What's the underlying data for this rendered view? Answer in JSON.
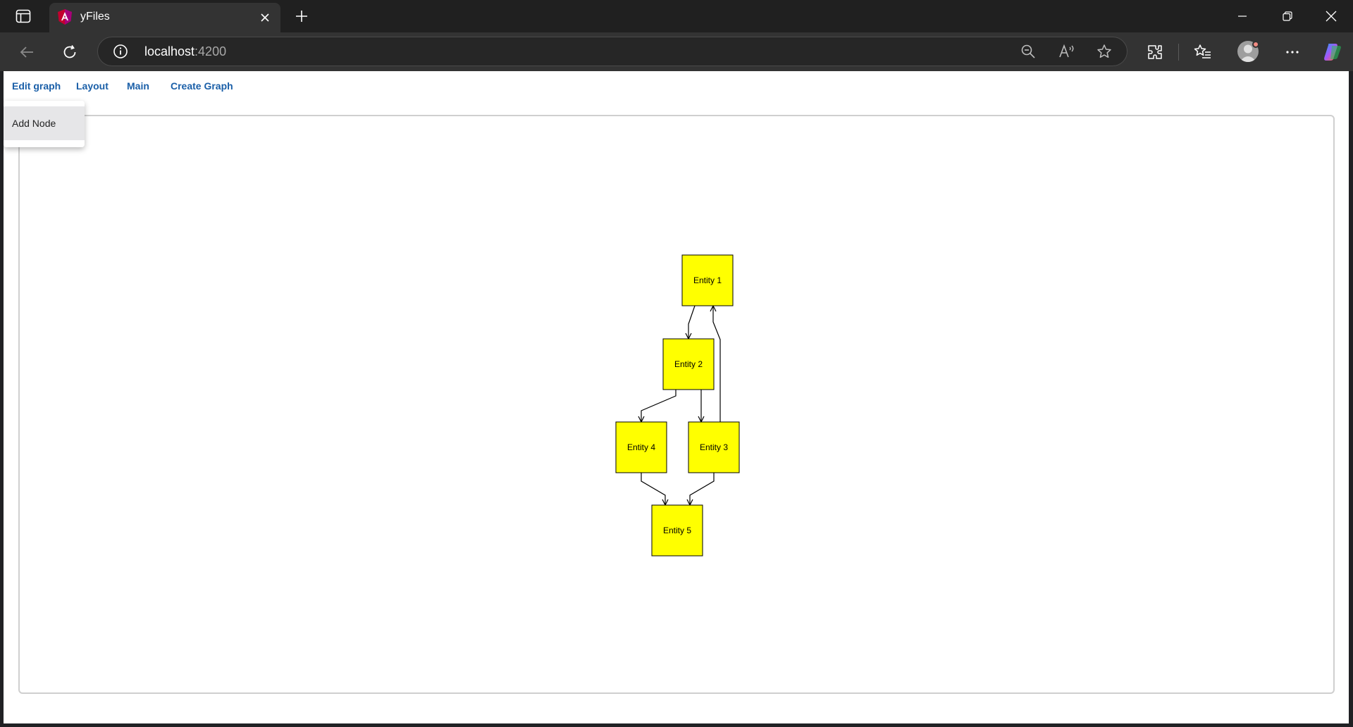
{
  "browser": {
    "tab_title": "yFiles",
    "address_host": "localhost",
    "address_port": ":4200"
  },
  "menu": {
    "items": [
      "Edit graph",
      "Layout",
      "Main",
      "Create Graph"
    ],
    "dropdown": {
      "items": [
        "Add Node"
      ]
    }
  },
  "graph": {
    "node_fill": "#ffff00",
    "node_stroke": "#000000",
    "nodes": [
      {
        "id": "e1",
        "label": "Entity 1"
      },
      {
        "id": "e2",
        "label": "Entity 2"
      },
      {
        "id": "e4",
        "label": "Entity 4"
      },
      {
        "id": "e3",
        "label": "Entity 3"
      },
      {
        "id": "e5",
        "label": "Entity 5"
      }
    ],
    "edges": [
      {
        "from": "e1",
        "to": "e2"
      },
      {
        "from": "e2",
        "to": "e4"
      },
      {
        "from": "e2",
        "to": "e3"
      },
      {
        "from": "e3",
        "to": "e1"
      },
      {
        "from": "e4",
        "to": "e5"
      },
      {
        "from": "e3",
        "to": "e5"
      }
    ]
  },
  "colors": {
    "titlebar": "#202020",
    "toolbar": "#333333",
    "link": "#1a5fa8",
    "copilot_gradient": [
      "#1fa2ff",
      "#a855f7",
      "#f97316"
    ]
  },
  "icons": [
    "sidebar-toggle-icon",
    "angular-favicon-icon",
    "close-icon",
    "plus-icon",
    "minimize-icon",
    "restore-icon",
    "window-close-icon",
    "back-icon",
    "refresh-icon",
    "info-icon",
    "zoom-out-icon",
    "read-aloud-icon",
    "favorite-star-icon",
    "extensions-icon",
    "favorites-icon",
    "profile-icon",
    "more-icon",
    "copilot-icon"
  ]
}
